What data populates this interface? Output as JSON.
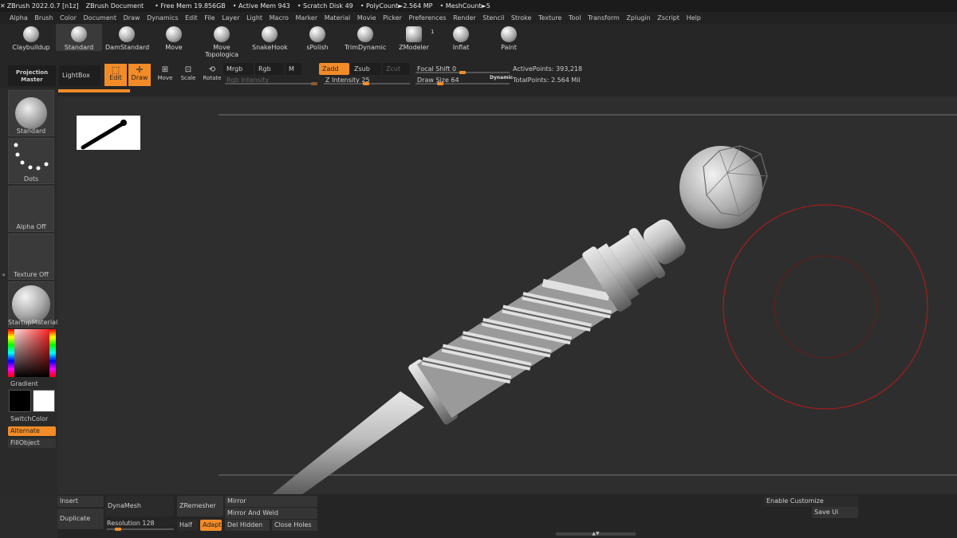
{
  "titlebar": {
    "app": "ZBrush 2022.0.7 [n1z]",
    "doc": "ZBrush Document",
    "free_mem": "• Free Mem 19.856GB",
    "active_mem": "• Active Mem 943",
    "scratch": "• Scratch Disk 49",
    "polycount": "• PolyCount►2.564 MP",
    "meshcount": "• MeshCount►5"
  },
  "menu": [
    "Alpha",
    "Brush",
    "Color",
    "Document",
    "Draw",
    "Dynamics",
    "Edit",
    "File",
    "Layer",
    "Light",
    "Macro",
    "Marker",
    "Material",
    "Movie",
    "Picker",
    "Preferences",
    "Render",
    "Stencil",
    "Stroke",
    "Texture",
    "Tool",
    "Transform",
    "Zplugin",
    "Zscript",
    "Help"
  ],
  "brushes": [
    "Claybuildup",
    "Standard",
    "DamStandard",
    "Move",
    "Move Topologica",
    "SnakeHook",
    "sPolish",
    "TrimDynamic",
    "ZModeler",
    "Inflat",
    "Paint"
  ],
  "zmodeler_badge": "1",
  "toolbar": {
    "projection": "Projection Master",
    "lightbox": "LightBox",
    "edit": "Edit",
    "draw": "Draw",
    "move": "Move",
    "scale": "Scale",
    "rotate": "Rotate",
    "mrgb": "Mrgb",
    "rgb": "Rgb",
    "m": "M",
    "rgb_intensity": "Rgb Intensity",
    "zadd": "Zadd",
    "zsub": "Zsub",
    "zcut": "Zcut",
    "z_intensity_label": "Z Intensity",
    "z_intensity": "25",
    "focal_label": "Focal Shift",
    "focal": "0",
    "drawsize_label": "Draw Size",
    "drawsize": "64",
    "dynamic": "Dynamic",
    "active_points": "ActivePoints: 393,218",
    "total_points": "TotalPoints: 2.564 Mil"
  },
  "left": {
    "standard": "Standard",
    "dots": "Dots",
    "alpha": "Alpha Off",
    "texture": "Texture Off",
    "material": "StartupMaterial",
    "gradient": "Gradient",
    "switchcolor": "SwitchColor",
    "alternate": "Alternate",
    "fillobject": "FillObject"
  },
  "bottom": {
    "insert": "Insert",
    "duplicate": "Duplicate",
    "dynamesh": "DynaMesh",
    "resolution_label": "Resolution",
    "resolution": "128",
    "zremesher": "ZRemesher",
    "half": "Half",
    "adapt": "Adapt",
    "mirror": "Mirror",
    "mirror_weld": "Mirror And Weld",
    "del_hidden": "Del Hidden",
    "close_holes": "Close Holes",
    "enable_customize": "Enable Customize",
    "save_ui": "Save Ui"
  },
  "colors": {
    "accent": "#f28c28",
    "brush_ring": "#9b1f1f"
  }
}
